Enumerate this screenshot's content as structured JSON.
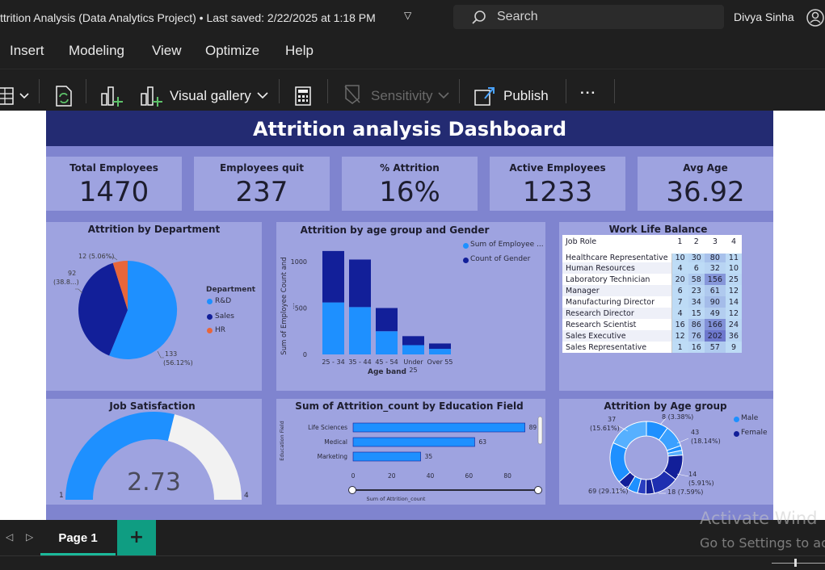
{
  "window": {
    "title": "ttrition Analysis (Data Analytics Project)  •  Last saved: 2/22/2025 at 1:18 PM",
    "search_label": "Search",
    "user_name": "Divya Sinha"
  },
  "menu": [
    "Insert",
    "Modeling",
    "View",
    "Optimize",
    "Help"
  ],
  "ribbon": {
    "visual_gallery": "Visual gallery",
    "sensitivity": "Sensitivity",
    "publish": "Publish",
    "more": "..."
  },
  "report": {
    "title": "Attrition analysis Dashboard",
    "kpis": [
      {
        "label": "Total Employees",
        "value": "1470"
      },
      {
        "label": "Employees quit",
        "value": "237"
      },
      {
        "label": "% Attrition",
        "value": "16%"
      },
      {
        "label": "Active Employees",
        "value": "1233"
      },
      {
        "label": "Avg Age",
        "value": "36.92"
      }
    ],
    "dept": {
      "title": "Attrition by Department",
      "legend_title": "Department",
      "legend": [
        "R&D",
        "Sales",
        "HR"
      ],
      "labels": {
        "hr": "12 (5.06%)",
        "sales_a": "92",
        "sales_b": "(38.8...)",
        "rd_a": "133",
        "rd_b": "(56.12%)"
      }
    },
    "age_gender": {
      "title": "Attrition by age group and Gender",
      "legend": [
        "Sum of Employee ...",
        "Count of Gender"
      ],
      "ylabel": "Sum of Employee Count and ...",
      "xlabel": "Age band",
      "yticks": [
        "1000",
        "500",
        "0"
      ],
      "xticks": [
        "25 - 34",
        "35 - 44",
        "45 - 54",
        "Under\n25",
        "Over 55"
      ]
    },
    "wlb": {
      "title": "Work Life Balance",
      "header": [
        "Job Role",
        "1",
        "2",
        "3",
        "4"
      ],
      "rows": [
        [
          "Healthcare Representative",
          "10",
          "30",
          "80",
          "11"
        ],
        [
          "Human Resources",
          "4",
          "6",
          "32",
          "10"
        ],
        [
          "Laboratory Technician",
          "20",
          "58",
          "156",
          "25"
        ],
        [
          "Manager",
          "6",
          "23",
          "61",
          "12"
        ],
        [
          "Manufacturing Director",
          "7",
          "34",
          "90",
          "14"
        ],
        [
          "Research Director",
          "4",
          "15",
          "49",
          "12"
        ],
        [
          "Research Scientist",
          "16",
          "86",
          "166",
          "24"
        ],
        [
          "Sales Executive",
          "12",
          "76",
          "202",
          "36"
        ],
        [
          "Sales Representative",
          "1",
          "16",
          "57",
          "9"
        ]
      ]
    },
    "job_sat": {
      "title": "Job Satisfaction",
      "value": "2.73",
      "min": "1",
      "max": "4"
    },
    "education": {
      "title": "Sum of Attrition_count by Education Field",
      "ylabel": "Education Field",
      "xlabel": "Sum of Attrition_count",
      "xticks": [
        "0",
        "20",
        "40",
        "60",
        "80"
      ]
    },
    "age_group": {
      "title": "Attrition by Age group",
      "legend": [
        "Male",
        "Female"
      ],
      "labels": {
        "l37a": "37",
        "l37b": "(15.61%)",
        "l8": "8 (3.38%)",
        "l43a": "43",
        "l43b": "(18.14%)",
        "l14a": "14",
        "l14b": "(5.91%)",
        "l18": "18 (7.59%)",
        "l69": "69 (29.11%)"
      }
    }
  },
  "pages": {
    "current": "Page 1",
    "add": "+"
  },
  "watermark": {
    "line1": "Activate Wind",
    "line2": "Go to Settings to ac"
  },
  "colors": {
    "header_band": "#232b72",
    "report_bg": "#7f84cf",
    "card_bg": "#9ea3e0",
    "light_blue": "#1e90ff",
    "dark_blue": "#121f99",
    "orange": "#e8663a"
  },
  "chart_data": [
    {
      "type": "pie",
      "title": "Attrition by Department",
      "categories": [
        "R&D",
        "Sales",
        "HR"
      ],
      "values": [
        133,
        92,
        12
      ],
      "percent": [
        56.12,
        38.8,
        5.06
      ]
    },
    {
      "type": "bar",
      "title": "Attrition by age group and Gender",
      "categories": [
        "25 - 34",
        "35 - 44",
        "45 - 54",
        "Under 25",
        "Over 55"
      ],
      "series": [
        {
          "name": "Sum of Employee ...",
          "values": [
            560,
            510,
            250,
            100,
            60
          ]
        },
        {
          "name": "Count of Gender",
          "values": [
            554,
            512,
            250,
            97,
            58
          ]
        }
      ],
      "ylim": [
        0,
        1200
      ],
      "xlabel": "Age band",
      "ylabel": "Sum of Employee Count and ..."
    },
    {
      "type": "bar",
      "title": "Sum of Attrition_count by Education Field",
      "categories": [
        "Life Sciences",
        "Medical",
        "Marketing"
      ],
      "values": [
        89,
        63,
        35
      ],
      "xlim": [
        0,
        90
      ]
    },
    {
      "type": "pie",
      "title": "Attrition by Age group",
      "categories": [
        "Male",
        "Female"
      ],
      "values": [
        37,
        8,
        43,
        14,
        18,
        69
      ]
    }
  ]
}
